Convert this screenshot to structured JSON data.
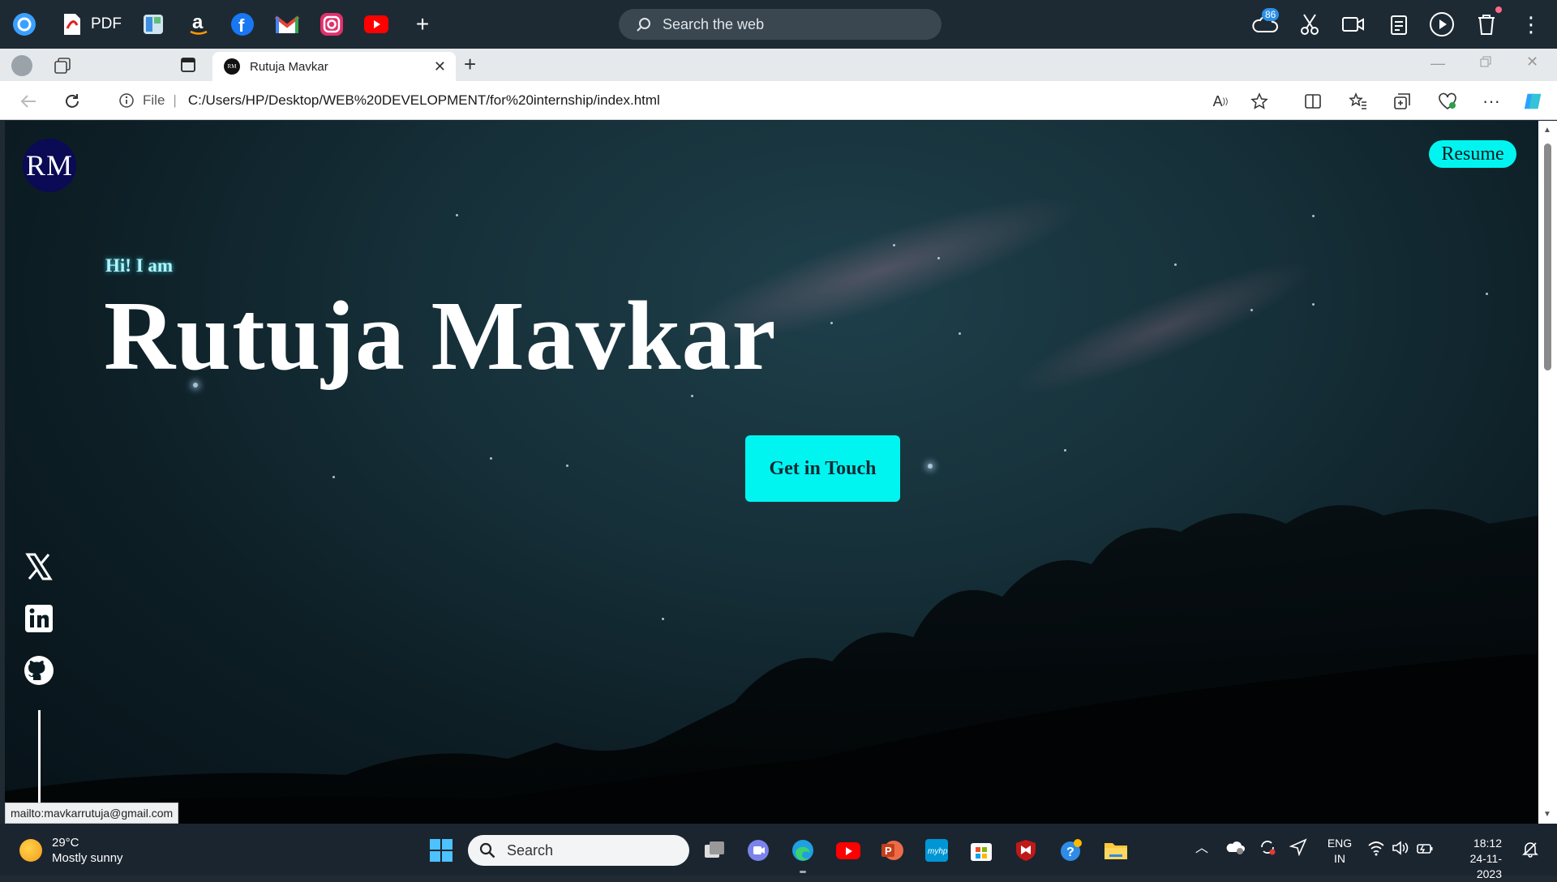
{
  "launcher": {
    "pdf_label": "PDF",
    "search_placeholder": "Search the web",
    "weather_badge": "86"
  },
  "tab": {
    "favicon_text": "RM",
    "title": "Rutuja Mavkar"
  },
  "address": {
    "file_label": "File",
    "url": "C:/Users/HP/Desktop/WEB%20DEVELOPMENT/for%20internship/index.html"
  },
  "page": {
    "logo_text": "RM",
    "resume_label": "Resume",
    "greeting": "Hi! I am",
    "name": "Rutuja Mavkar",
    "cta_label": "Get in Touch",
    "social": [
      "x-icon",
      "linkedin-icon",
      "github-icon"
    ],
    "accent_color": "#00f5f0",
    "status_url": "mailto:mavkarrutuja@gmail.com"
  },
  "taskbar": {
    "temp": "29°C",
    "condition": "Mostly sunny",
    "search_label": "Search",
    "lang_line1": "ENG",
    "lang_line2": "IN",
    "time": "18:12",
    "date": "24-11-2023"
  }
}
